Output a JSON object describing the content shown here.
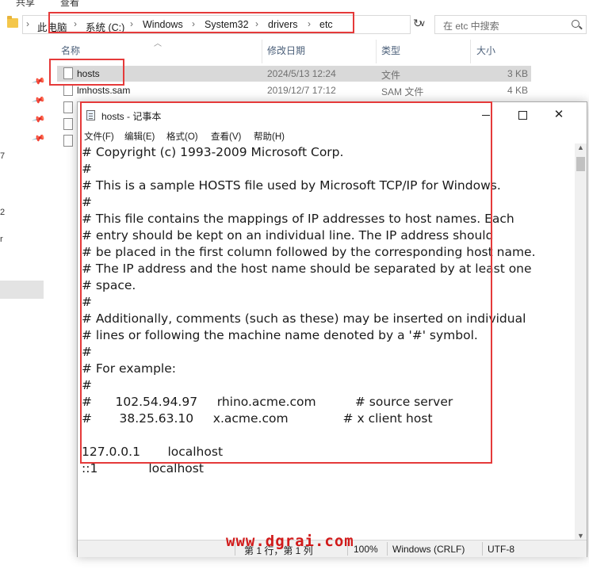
{
  "explorer": {
    "ribbon_tabs": [
      "共享",
      "查看"
    ],
    "breadcrumb": [
      "此电脑",
      "系统 (C:)",
      "Windows",
      "System32",
      "drivers",
      "etc"
    ],
    "search_placeholder": "在 etc 中搜索",
    "columns": {
      "name": "名称",
      "date": "修改日期",
      "type": "类型",
      "size": "大小"
    },
    "files": [
      {
        "name": "hosts",
        "date": "2024/5/13 12:24",
        "type": "文件",
        "size": "3 KB"
      },
      {
        "name": "lmhosts.sam",
        "date": "2019/12/7 17:12",
        "type": "SAM 文件",
        "size": "4 KB"
      }
    ],
    "left_pane_fragments": [
      "7",
      "2",
      "r"
    ]
  },
  "notepad": {
    "title": "hosts - 记事本",
    "menu": [
      "文件(F)",
      "编辑(E)",
      "格式(O)",
      "查看(V)",
      "帮助(H)"
    ],
    "lines": [
      "# Copyright (c) 1993-2009 Microsoft Corp.",
      "#",
      "# This is a sample HOSTS file used by Microsoft TCP/IP for Windows.",
      "#",
      "# This file contains the mappings of IP addresses to host names. Each",
      "# entry should be kept on an individual line. The IP address should",
      "# be placed in the first column followed by the corresponding host name.",
      "# The IP address and the host name should be separated by at least one",
      "# space.",
      "#",
      "# Additionally, comments (such as these) may be inserted on individual",
      "# lines or following the machine name denoted by a '#' symbol.",
      "#",
      "# For example:",
      "#",
      "#      102.54.94.97     rhino.acme.com          # source server",
      "#       38.25.63.10     x.acme.com              # x client host",
      "",
      "127.0.0.1       localhost",
      "::1             localhost"
    ],
    "status": {
      "position": "第 1 行，第 1 列",
      "zoom": "100%",
      "line_ending": "Windows (CRLF)",
      "encoding": "UTF-8"
    }
  },
  "watermark": "www.dgrai.com",
  "colors": {
    "highlight": "#e53a3a",
    "watermark": "#d11a1a",
    "selection": "#d9d9d9"
  }
}
